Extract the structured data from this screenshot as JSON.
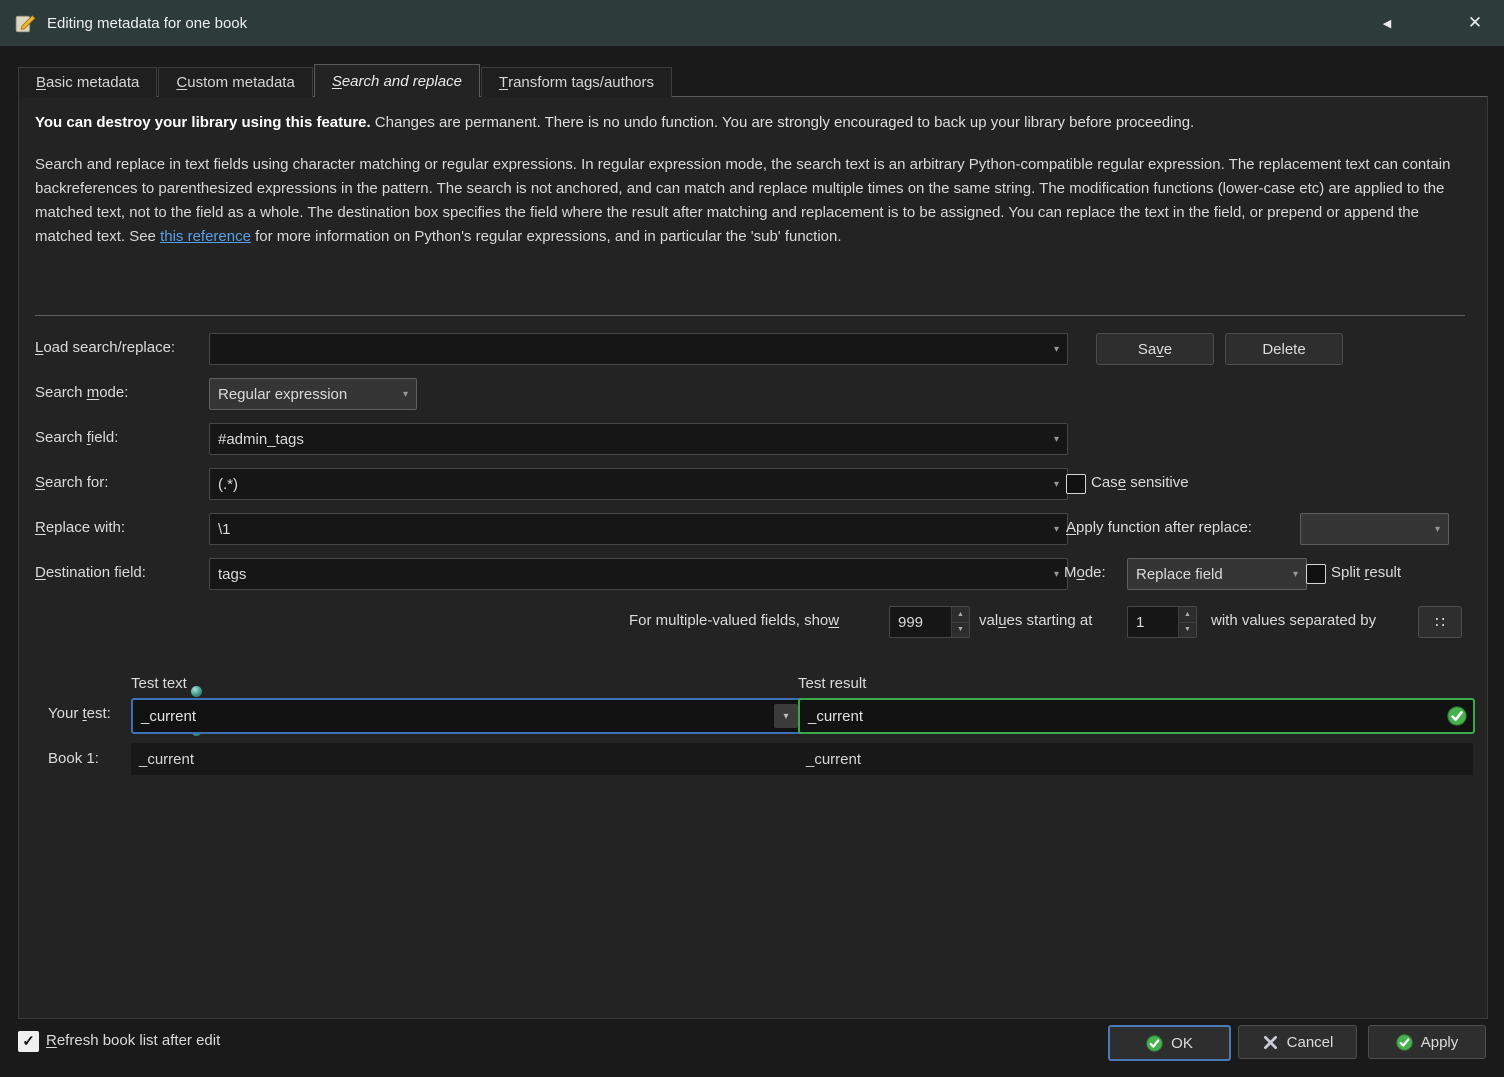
{
  "titlebar": {
    "title": "Editing metadata for one book",
    "collapse_icon": "◀",
    "close_icon": "✕"
  },
  "tabs": [
    {
      "label_html": "<u>B</u>asic metadata"
    },
    {
      "label_html": "<u>C</u>ustom metadata"
    },
    {
      "label_html": "<u>S</u>earch and replace"
    },
    {
      "label_html": "<u>T</u>ransform tags/authors"
    }
  ],
  "warning": {
    "bold": "You can destroy your library using this feature.",
    "rest": " Changes are permanent. There is no undo function. You are strongly encouraged to back up your library before proceeding."
  },
  "description": {
    "before": "Search and replace in text fields using character matching or regular expressions. In regular expression mode, the search text is an arbitrary Python-compatible regular expression. The replacement text can contain backreferences to parenthesized expressions in the pattern. The search is not anchored, and can match and replace multiple times on the same string. The modification functions (lower-case etc) are applied to the matched text, not to the field as a whole. The destination box specifies the field where the result after matching and replacement is to be assigned. You can replace the text in the field, or prepend or append the matched text. See ",
    "link": "this reference",
    "after": " for more information on Python's regular expressions, and in particular the 'sub' function."
  },
  "form": {
    "load_label_html": "<u>L</u>oad search/replace:",
    "load_value": "",
    "save_button_html": "Sa<u>v</u>e",
    "delete_button": "Delete",
    "search_mode_label_html": "Search <u>m</u>ode:",
    "search_mode_value": "Regular expression",
    "search_field_label_html": "Search <u>f</u>ield:",
    "search_field_value": "#admin_tags",
    "search_for_label_html": "<u>S</u>earch for:",
    "search_for_value": "(.*)",
    "case_sensitive_label_html": "Cas<u>e</u> sensitive",
    "replace_with_label_html": "<u>R</u>eplace with:",
    "replace_with_value": "\\1",
    "apply_function_label_html": "<u>A</u>pply function after replace:",
    "apply_function_value": "",
    "destination_label_html": "<u>D</u>estination field:",
    "destination_value": "tags",
    "mode_label_html": "M<u>o</u>de:",
    "mode_value": "Replace field",
    "split_result_label_html": "Split <u>r</u>esult",
    "multi_show_label_html": "For multiple-valued fields, sho<u>w</u>",
    "multi_show_value": "999",
    "multi_start_label_html": "val<u>u</u>es starting at",
    "multi_start_value": "1",
    "multi_sep_label_html": "with values separated by",
    "multi_sep_value": "∷"
  },
  "test": {
    "text_header": "Test text",
    "result_header": "Test result",
    "your_test_label_html": "Your <u>t</u>est:",
    "your_test_value": "_current",
    "your_test_result": "_current",
    "book1_label": "Book 1:",
    "book1_value": "_current",
    "book1_result": "_current"
  },
  "footer": {
    "refresh_label_html": "<u>R</u>efresh book list after edit",
    "ok_label": "OK",
    "cancel_label": "Cancel",
    "apply_label": "Apply"
  },
  "icons": {
    "chevron_down": "▾",
    "spin_up": "▲",
    "spin_down": "▼",
    "check": "✓"
  },
  "colors": {
    "titlebar": "#2e3c39",
    "panel": "#232323",
    "window_bg": "#1a1a1a",
    "focus_blue": "#3d6fb4",
    "success_green": "#3aa74a",
    "link_blue": "#58a0e8"
  }
}
